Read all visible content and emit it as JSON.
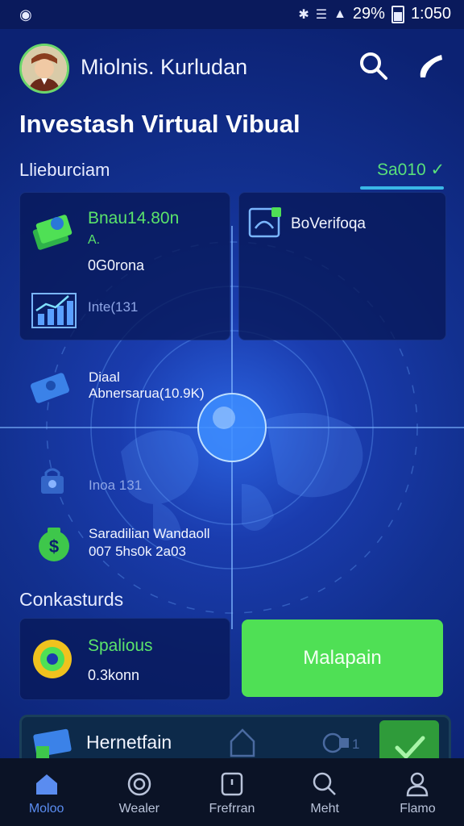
{
  "status_bar": {
    "battery": "29%",
    "time": "1:050"
  },
  "header": {
    "user_name": "Miolnis. Kurludan",
    "search_icon": "search-icon",
    "phone_icon": "phone-icon"
  },
  "page": {
    "title": "Investash Virtual Vibual"
  },
  "section": {
    "label": "Llieburciam",
    "status": "Sa010 ✓"
  },
  "card_left": {
    "amount": "Bnau14.80n",
    "sub": "A.",
    "value": "0G0rona",
    "chart_label": "Inte(131"
  },
  "card_right": {
    "title": "BoVerifoqa"
  },
  "items": [
    {
      "line1": "Diaal",
      "line2": "Abnersarua(10.9K)",
      "icon": "wallet-icon"
    },
    {
      "line1": "Inoa 131",
      "icon": "lock-icon"
    },
    {
      "line1": "Saradilian Wandaoll",
      "line2": "007 5hs0k 2a03",
      "icon": "dollar-icon"
    }
  ],
  "contacts": {
    "label": "Conkasturds",
    "card_title": "Spalious",
    "card_value": "0.3konn",
    "button_label": "Malapain"
  },
  "bottom_card": {
    "label": "Hernetfain",
    "count": "1"
  },
  "nav": [
    {
      "label": "Moloo",
      "icon": "home-icon"
    },
    {
      "label": "Wealer",
      "icon": "target-icon"
    },
    {
      "label": "Frefrran",
      "icon": "tablet-icon"
    },
    {
      "label": "Meht",
      "icon": "search-icon"
    },
    {
      "label": "Flamo",
      "icon": "profile-icon"
    }
  ],
  "colors": {
    "accent_green": "#4fe055",
    "background_blue": "#12308f",
    "nav_active": "#5a8cf0"
  }
}
